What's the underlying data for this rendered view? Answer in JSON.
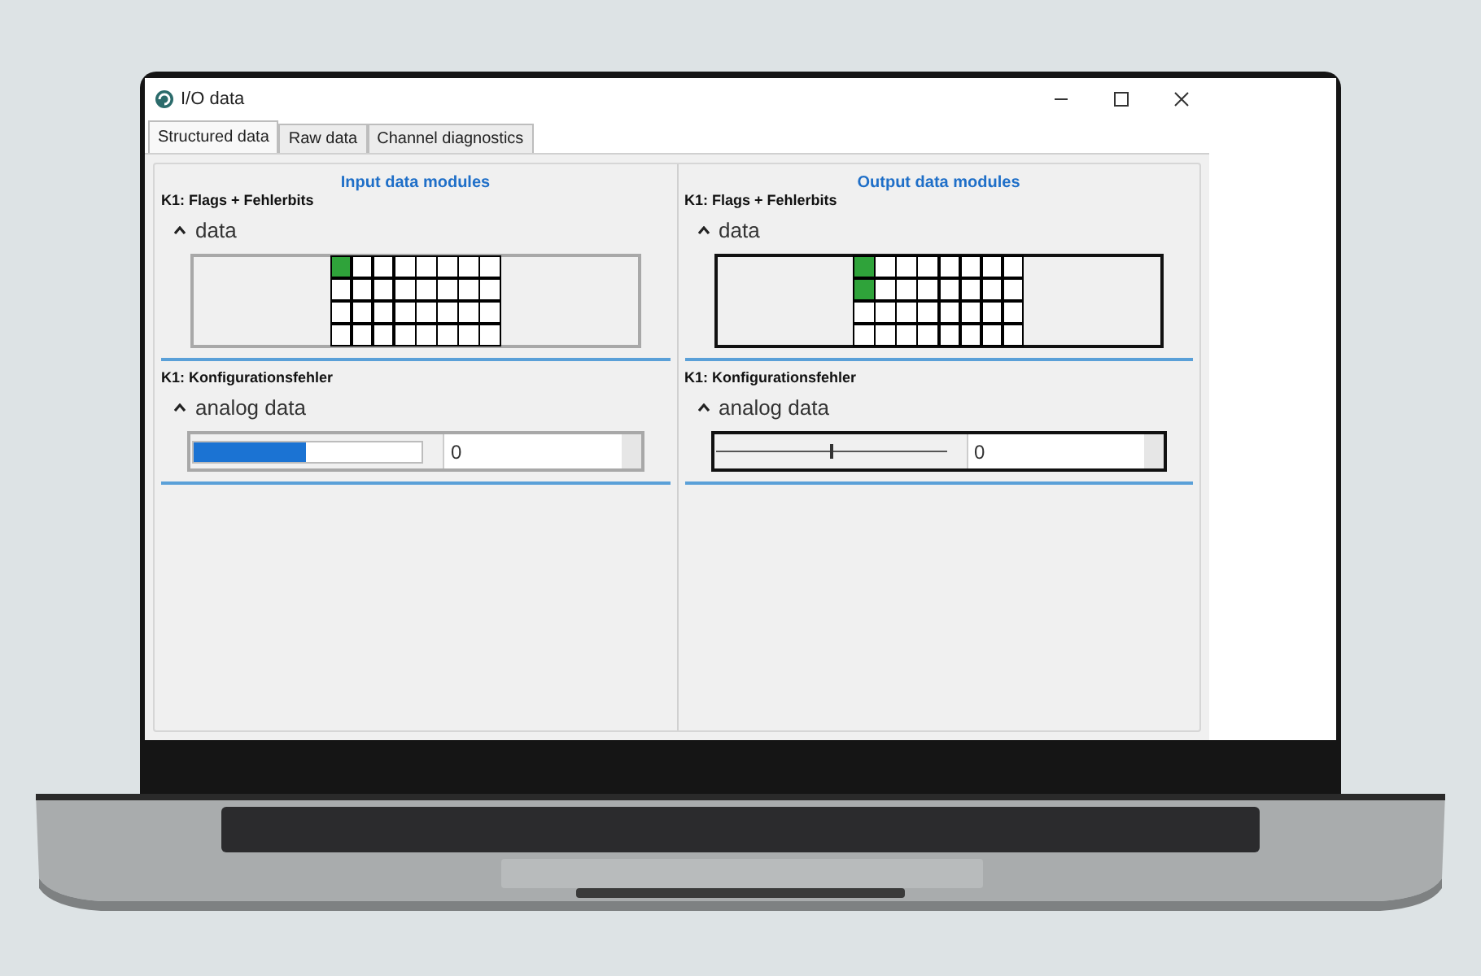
{
  "window": {
    "title": "I/O data"
  },
  "tabs": [
    {
      "label": "Structured data",
      "selected": true
    },
    {
      "label": "Raw data",
      "selected": false
    },
    {
      "label": "Channel diagnostics",
      "selected": false
    }
  ],
  "panels": [
    {
      "heading": "Input data modules",
      "editable": false,
      "sections": [
        {
          "title": "K1: Flags + Fehlerbits",
          "group": "data",
          "expanded": true,
          "kind": "bits",
          "bits": [
            [
              true,
              false,
              false,
              false,
              false,
              false,
              false,
              false
            ],
            [
              false,
              false,
              false,
              false,
              false,
              false,
              false,
              false
            ],
            [
              false,
              false,
              false,
              false,
              false,
              false,
              false,
              false
            ],
            [
              false,
              false,
              false,
              false,
              false,
              false,
              false,
              false
            ]
          ]
        },
        {
          "title": "K1: Konfigurationsfehler",
          "group": "analog data",
          "expanded": true,
          "kind": "progress",
          "level": 0.49,
          "value": "0"
        }
      ]
    },
    {
      "heading": "Output data modules",
      "editable": true,
      "sections": [
        {
          "title": "K1: Flags + Fehlerbits",
          "group": "data",
          "expanded": true,
          "kind": "bits",
          "bits": [
            [
              true,
              false,
              false,
              false,
              false,
              false,
              false,
              false
            ],
            [
              true,
              false,
              false,
              false,
              false,
              false,
              false,
              false
            ],
            [
              false,
              false,
              false,
              false,
              false,
              false,
              false,
              false
            ],
            [
              false,
              false,
              false,
              false,
              false,
              false,
              false,
              false
            ]
          ]
        },
        {
          "title": "K1: Konfigurationsfehler",
          "group": "analog data",
          "expanded": true,
          "kind": "slider",
          "level": 0.5,
          "value": "0"
        }
      ]
    }
  ]
}
